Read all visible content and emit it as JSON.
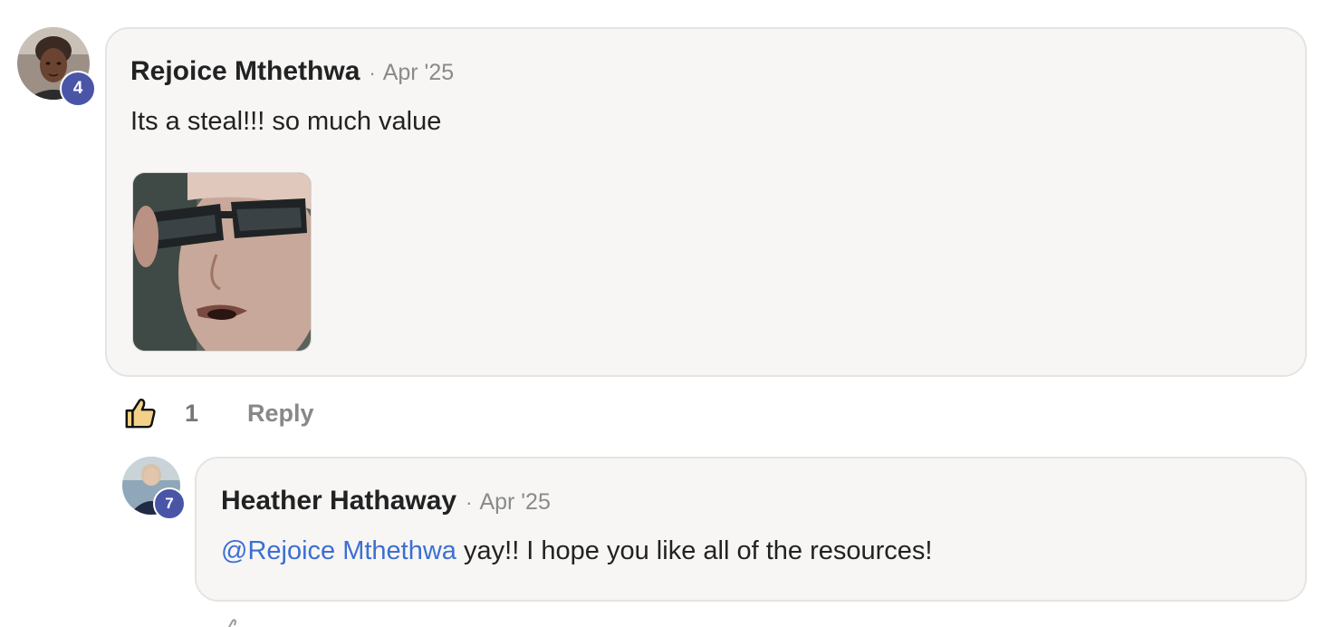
{
  "comment": {
    "author": "Rejoice Mthethwa",
    "separator": "·",
    "date": "Apr '25",
    "text": "Its a steal!!! so much value",
    "avatar_level": "4",
    "gif_alt": "",
    "likes": "1",
    "reply_label": "Reply"
  },
  "reply": {
    "author": "Heather Hathaway",
    "separator": "·",
    "date": "Apr '25",
    "mention": "@Rejoice Mthethwa",
    "text": " yay!! I hope you like all of the resources!",
    "avatar_level": "7"
  },
  "icons": {
    "like": "thumbs-up-icon"
  },
  "colors": {
    "badge": "#4a55a8",
    "mention": "#3c6fd1",
    "bubble_bg": "#f7f6f5"
  }
}
